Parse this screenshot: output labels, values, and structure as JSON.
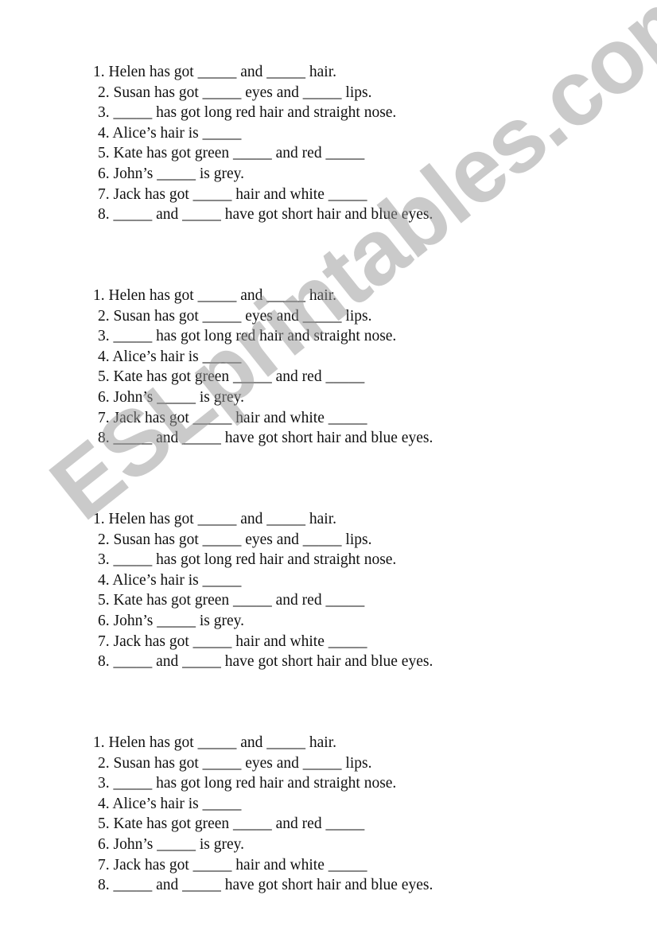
{
  "worksheet": {
    "blocks": [
      {
        "lines": [
          "1. Helen has got _____ and _____ hair.",
          "2. Susan has got _____ eyes and _____ lips.",
          "3. _____ has got long red hair and straight nose.",
          "4. Alice’s hair is _____",
          "5. Kate has got green _____ and red _____",
          "6. John’s _____ is grey.",
          "7. Jack has got _____ hair and white _____",
          "8. _____ and _____ have got short hair and blue eyes."
        ]
      },
      {
        "lines": [
          "1. Helen has got _____ and _____ hair.",
          "2. Susan has got _____ eyes and _____ lips.",
          "3. _____ has got long red hair and straight nose.",
          "4. Alice’s hair is _____",
          "5. Kate has got green _____ and red _____",
          "6. John’s _____ is grey.",
          "7. Jack has got _____ hair and white _____",
          "8. _____ and _____ have got short hair and blue eyes."
        ]
      },
      {
        "lines": [
          "1. Helen has got _____ and _____ hair.",
          "2. Susan has got _____ eyes and _____ lips.",
          "3. _____ has got long red hair and straight nose.",
          "4. Alice’s hair is _____",
          "5. Kate has got green _____ and red _____",
          "6. John’s _____ is grey.",
          "7. Jack has got _____ hair and white _____",
          "8. _____ and _____ have got short hair and blue eyes."
        ]
      },
      {
        "lines": [
          "1. Helen has got _____ and _____ hair.",
          "2. Susan has got _____ eyes and _____ lips.",
          "3. _____ has got long red hair and straight nose.",
          "4. Alice’s hair is _____",
          "5. Kate has got green _____ and red _____",
          "6. John’s _____ is grey.",
          "7. Jack has got _____ hair and white _____",
          "8. _____ and _____ have got short hair and blue eyes."
        ]
      }
    ]
  },
  "watermark": {
    "text": "ESLprintables.com",
    "color": "#c8c8c8"
  }
}
